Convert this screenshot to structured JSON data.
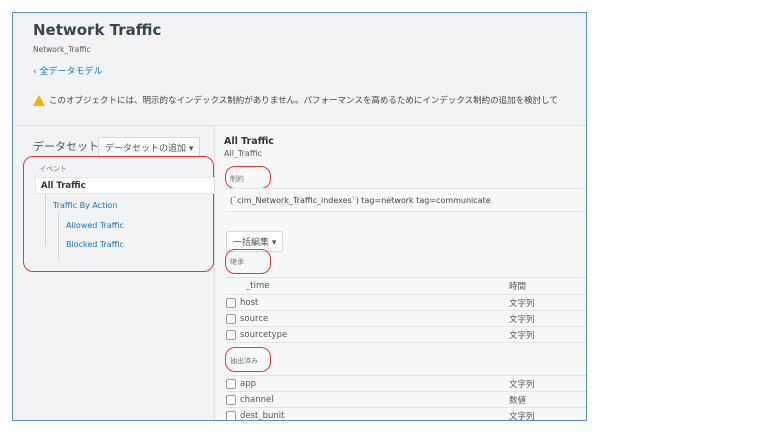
{
  "header": {
    "title": "Network Traffic",
    "subtitle": "Network_Traffic",
    "back_link": "全データモデル",
    "warning": "このオブジェクトには、明示的なインデックス制約がありません。パフォーマンスを高めるためにインデックス制約の追加を検討して"
  },
  "left": {
    "datasets_label": "データセット",
    "add_dataset": "データセットの追加 ▾",
    "section": "イベント",
    "items": [
      "All Traffic",
      "Traffic By Action",
      "Allowed Traffic",
      "Blocked Traffic"
    ]
  },
  "right": {
    "title": "All Traffic",
    "subtitle": "All_Traffic",
    "constraints_label": "制約",
    "constraint": "(`cim_Network_Traffic_indexes`) tag=network tag=communicate",
    "bulk_edit": "一括編集 ▾",
    "inherited_label": "継承",
    "inherited": [
      {
        "name": "_time",
        "type": "時間"
      },
      {
        "name": "host",
        "type": "文字列"
      },
      {
        "name": "source",
        "type": "文字列"
      },
      {
        "name": "sourcetype",
        "type": "文字列"
      }
    ],
    "extracted_label": "抽出済み",
    "extracted": [
      {
        "name": "app",
        "type": "文字列"
      },
      {
        "name": "channel",
        "type": "数値"
      },
      {
        "name": "dest_bunit",
        "type": "文字列"
      }
    ]
  },
  "colors": {
    "accent": "#1a73b8",
    "highlight": "#e53935"
  }
}
